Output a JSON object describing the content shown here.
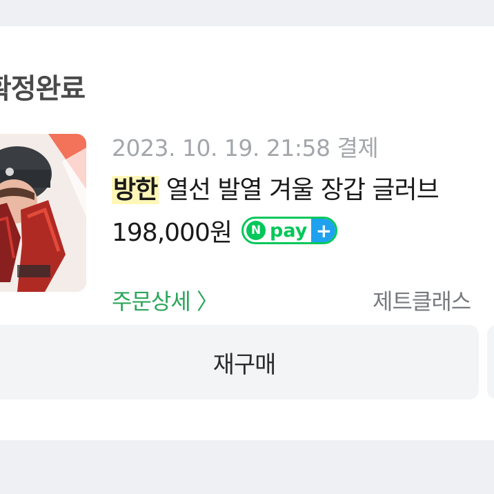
{
  "order": {
    "status": "확정완료",
    "date_text": "2023. 10. 19. 21:58 결제",
    "product": {
      "brand": "방한",
      "name": "열선 발열 겨울 장갑 글러브",
      "price": "198,000원",
      "image_icon": "product-photo-helmet-gloves"
    },
    "payment": {
      "method_icon": "npay-plus-badge",
      "n_letter": "N",
      "label": "pay",
      "plus": "+",
      "brand_color": "#03c75a",
      "plus_color": "#1ea1ee"
    },
    "detail_link": "주문상세 〉",
    "seller": "제트클래스"
  },
  "actions": {
    "rebuy_label": "재구매"
  },
  "colors": {
    "background": "#eef0f3",
    "card": "#ffffff",
    "link_green": "#2aa65a",
    "brand_highlight": "#fff7b8"
  }
}
